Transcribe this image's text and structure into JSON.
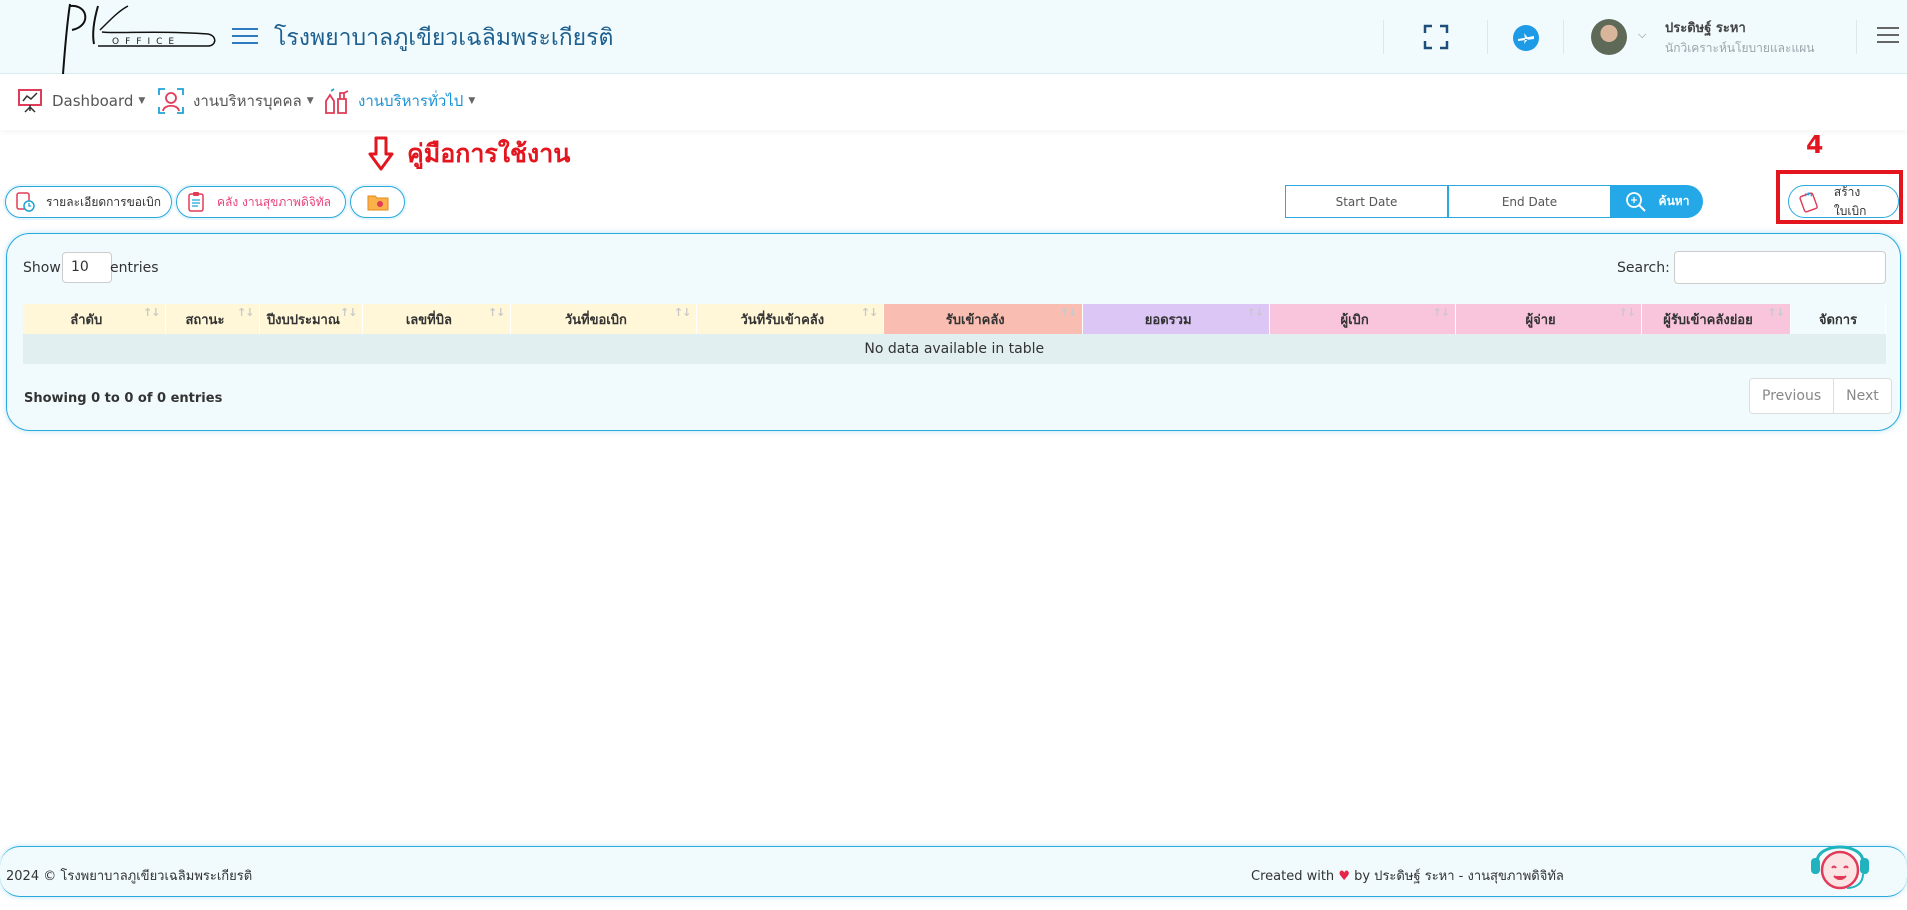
{
  "header": {
    "logo_text": "OFFICE",
    "hospital_title": "โรงพยาบาลภูเขียวเฉลิมพระเกียรติ",
    "user_name": "ประดิษฐ์ ระหา",
    "user_role": "นักวิเคราะห์นโยบายและแผน",
    "icons": [
      "menu-icon",
      "fullscreen-icon",
      "airplane-icon",
      "avatar",
      "chevron-down-icon",
      "menu-icon"
    ]
  },
  "nav": {
    "items": [
      {
        "label": "Dashboard",
        "icon": "presentation-icon"
      },
      {
        "label": "งานบริหารบุคคล",
        "icon": "person-icon"
      },
      {
        "label": "งานบริหารทั่วไป",
        "icon": "cleaning-icon",
        "active": true
      }
    ]
  },
  "annotation": {
    "manual_label": "คู่มือการใช้งาน",
    "step_number": "4"
  },
  "toolbar": {
    "detail_button": "รายละเอียดการขอเบิก",
    "warehouse_button": "คลัง งานสุขภาพดิจิทัล",
    "start_date_placeholder": "Start Date",
    "end_date_placeholder": "End Date",
    "search_button": "ค้นหา",
    "create_button": "สร้างใบเบิก"
  },
  "table": {
    "show_label": "Show",
    "page_length": "10",
    "entries_label": "entries",
    "search_label": "Search:",
    "columns": [
      "ลำดับ",
      "สถานะ",
      "ปีงบประมาณ",
      "เลขที่บิล",
      "วันที่ขอเบิก",
      "วันที่รับเข้าคลัง",
      "รับเข้าคลัง",
      "ยอดรวม",
      "ผู้เบิก",
      "ผู้จ่าย",
      "ผู้รับเข้าคลังย่อย",
      "จัดการ"
    ],
    "empty_message": "No data available in table",
    "info": "Showing 0 to 0 of 0 entries",
    "previous": "Previous",
    "next": "Next"
  },
  "footer": {
    "left": "2024 © โรงพยาบาลภูเขียวเฉลิมพระเกียรติ",
    "created_with": "Created with",
    "by_text": "by ประดิษฐ์ ระหา - งานสุขภาพดิจิทัล"
  },
  "colors": {
    "accent": "#24a8e8",
    "title": "#1d5f8f",
    "annotation_red": "#e3161f",
    "header_bg": "#f1fbfd"
  }
}
